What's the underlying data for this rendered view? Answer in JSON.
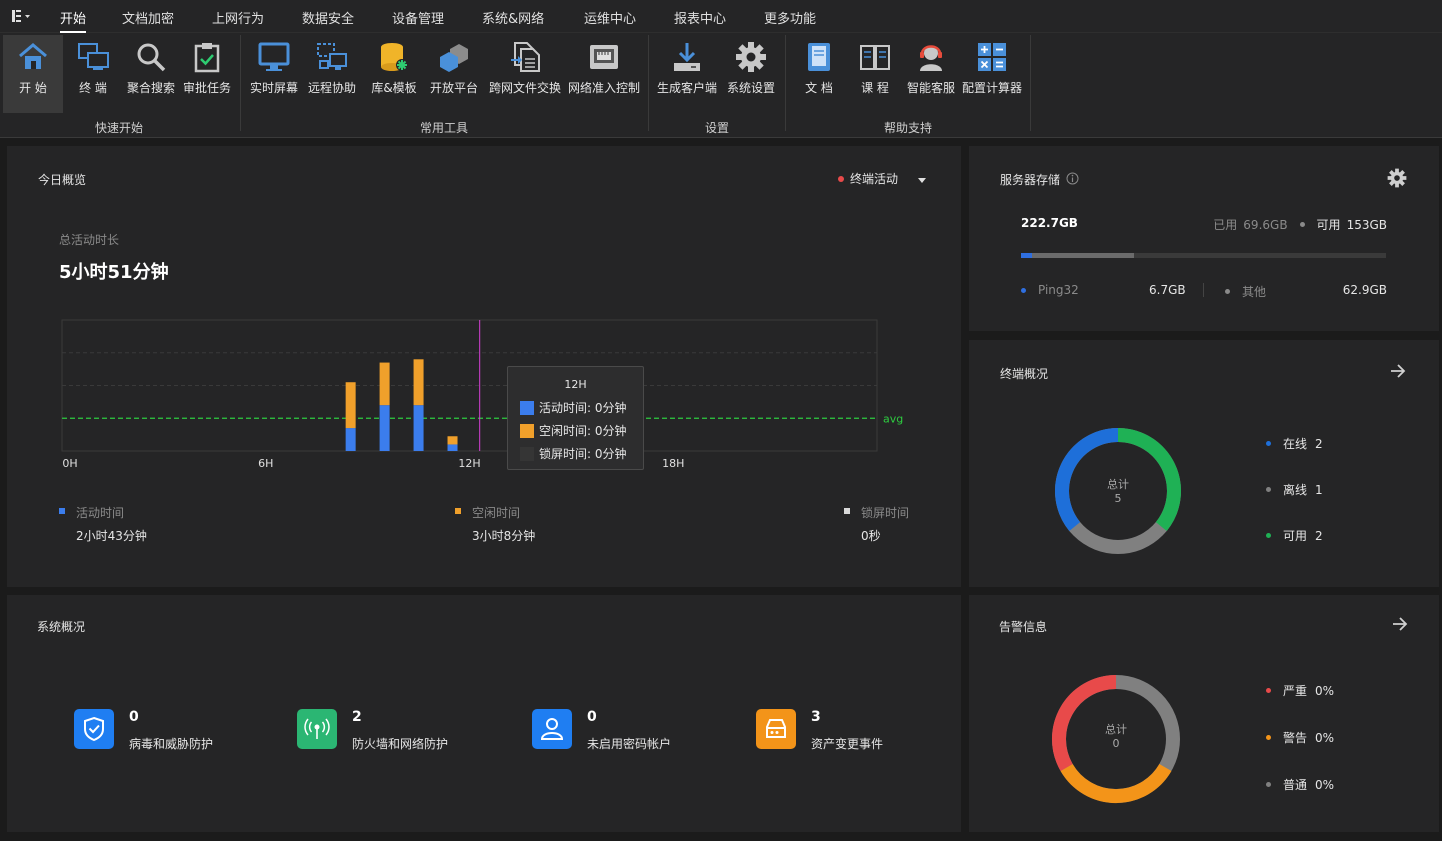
{
  "colors": {
    "active": "#3b7ded",
    "idle": "#f0a02b",
    "lock": "#d9d9d9",
    "online": "#1e6fd9",
    "offline": "#808080",
    "available": "#1fb155",
    "severe": "#e84a4a",
    "warning": "#f39419",
    "normal": "#808080"
  },
  "menubar": {
    "tabs": [
      "开始",
      "文档加密",
      "上网行为",
      "数据安全",
      "设备管理",
      "系统&网络",
      "运维中心",
      "报表中心",
      "更多功能"
    ]
  },
  "ribbon": {
    "buttons": [
      "开 始",
      "终 端",
      "聚合搜索",
      "审批任务",
      "实时屏幕",
      "远程协助",
      "库&模板",
      "开放平台",
      "跨网文件交换",
      "网络准入控制",
      "生成客户端",
      "系统设置",
      "文 档",
      "课 程",
      "智能客服",
      "配置计算器"
    ],
    "icons": [
      "home-icon",
      "terminal-icon",
      "search-icon",
      "approval-icon",
      "screen-icon",
      "remote-icon",
      "library-icon",
      "platform-icon",
      "file-exchange-icon",
      "network-access-icon",
      "download-client-icon",
      "gear-icon",
      "document-icon",
      "course-icon",
      "support-icon",
      "calculator-icon"
    ],
    "groups": [
      "快速开始",
      "常用工具",
      "设置",
      "帮助支持"
    ]
  },
  "today": {
    "title": "今日概览",
    "filter_label": "终端活动",
    "total_label": "总活动时长",
    "total_value": "5小时51分钟",
    "avg_label": "avg",
    "legend": [
      {
        "label": "活动时间",
        "value": "2小时43分钟"
      },
      {
        "label": "空闲时间",
        "value": "3小时8分钟"
      },
      {
        "label": "锁屏时间",
        "value": "0秒"
      }
    ],
    "tooltip": {
      "title": "12H",
      "rows": [
        "活动时间: 0分钟",
        "空闲时间: 0分钟",
        "锁屏时间: 0分钟"
      ]
    }
  },
  "chart_data": {
    "type": "bar",
    "stacked": true,
    "x_ticks": [
      "0H",
      "6H",
      "12H",
      "18H"
    ],
    "x_range": [
      0,
      24
    ],
    "y_range": [
      0,
      4
    ],
    "grid": true,
    "avg_y": 1,
    "hover_x": 12.3,
    "series": [
      {
        "name": "活动时间",
        "x": [
          8.5,
          9.5,
          10.5,
          11.5
        ],
        "values": [
          0.7,
          1.4,
          1.4,
          0.2
        ]
      },
      {
        "name": "空闲时间",
        "x": [
          8.5,
          9.5,
          10.5,
          11.5
        ],
        "values": [
          1.4,
          1.3,
          1.4,
          0.25
        ]
      }
    ]
  },
  "storage": {
    "title": "服务器存储",
    "total": "222.7GB",
    "used_label": "已用",
    "used_value": "69.6GB",
    "available_label": "可用",
    "available_value": "153GB",
    "used_fraction": 0.31,
    "ping_fraction": 0.03,
    "items": [
      {
        "label": "Ping32",
        "value": "6.7GB"
      },
      {
        "label": "其他",
        "value": "62.9GB"
      }
    ]
  },
  "terminals": {
    "title": "终端概况",
    "center_label": "总计",
    "center_value": "5",
    "legend": [
      {
        "label": "在线",
        "value": "2"
      },
      {
        "label": "离线",
        "value": "1"
      },
      {
        "label": "可用",
        "value": "2"
      }
    ]
  },
  "system": {
    "title": "系统概况",
    "items": [
      {
        "value": "0",
        "label": "病毒和威胁防护"
      },
      {
        "value": "2",
        "label": "防火墙和网络防护"
      },
      {
        "value": "0",
        "label": "未启用密码帐户"
      },
      {
        "value": "3",
        "label": "资产变更事件"
      }
    ]
  },
  "alerts": {
    "title": "告警信息",
    "center_label": "总计",
    "center_value": "0",
    "legend": [
      {
        "label": "严重",
        "value": "0%"
      },
      {
        "label": "警告",
        "value": "0%"
      },
      {
        "label": "普通",
        "value": "0%"
      }
    ]
  }
}
